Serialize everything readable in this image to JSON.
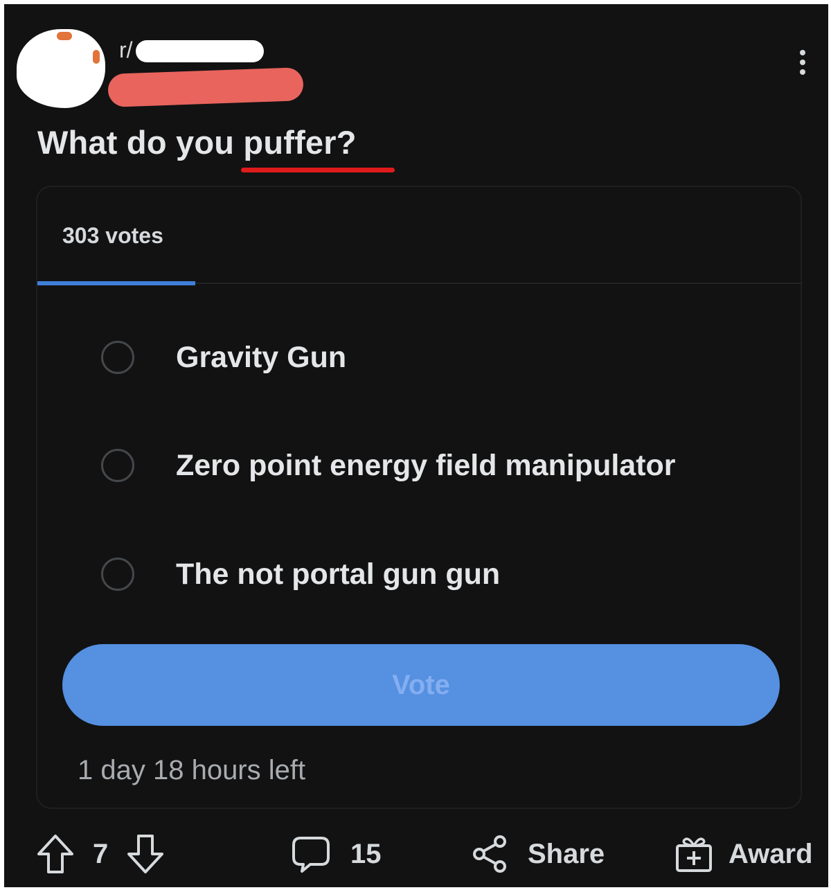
{
  "header": {
    "subreddit_prefix": "r/",
    "more_icon": "more-vertical-icon"
  },
  "post": {
    "title": "What do you puffer?"
  },
  "poll": {
    "votes_label": "303 votes",
    "options": [
      {
        "label": "Gravity Gun"
      },
      {
        "label": "Zero point energy field manipulator"
      },
      {
        "label": "The not portal gun gun"
      }
    ],
    "vote_button": "Vote",
    "time_left": "1 day 18 hours left",
    "accent_color": "#5590e1"
  },
  "actions": {
    "upvote_icon": "arrow-up-icon",
    "score": "7",
    "downvote_icon": "arrow-down-icon",
    "comment_icon": "comment-bubble-icon",
    "comments": "15",
    "share_icon": "share-icon",
    "share": "Share",
    "award_icon": "gift-award-icon",
    "award": "Award"
  },
  "colors": {
    "background": "#121213",
    "tab_indicator": "#3f7fd8",
    "spellcheck_underline": "#e01b1b",
    "redaction_red": "#e8645d"
  }
}
